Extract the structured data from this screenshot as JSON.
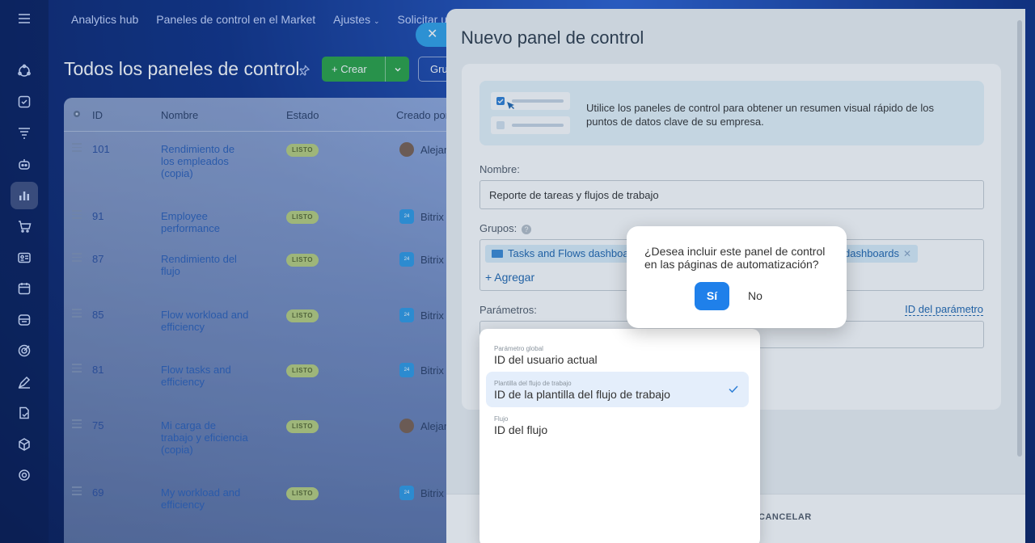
{
  "topnav": {
    "items": [
      "Analytics hub",
      "Paneles de control en el Market",
      "Ajustes",
      "Solicitar u"
    ]
  },
  "page": {
    "title": "Todos los paneles de control",
    "create_label": "+ Crear",
    "groups_label": "Gru"
  },
  "table": {
    "headers": {
      "id": "ID",
      "name": "Nombre",
      "status": "Estado",
      "creator": "Creado por"
    },
    "rows": [
      {
        "id": "101",
        "name": "Rendimiento de los empleados (copia)",
        "status": "LISTO",
        "creator": "Alejan"
      },
      {
        "id": "91",
        "name": "Employee performance",
        "status": "LISTO",
        "creator": "Bitrix"
      },
      {
        "id": "87",
        "name": "Rendimiento del flujo",
        "status": "LISTO",
        "creator": "Bitrix"
      },
      {
        "id": "85",
        "name": "Flow workload and efficiency",
        "status": "LISTO",
        "creator": "Bitrix"
      },
      {
        "id": "81",
        "name": "Flow tasks and efficiency",
        "status": "LISTO",
        "creator": "Bitrix"
      },
      {
        "id": "75",
        "name": "Mi carga de trabajo y eficiencia (copia)",
        "status": "LISTO",
        "creator": "Alejan"
      },
      {
        "id": "69",
        "name": "My workload and efficiency",
        "status": "LISTO",
        "creator": "Bitrix"
      }
    ],
    "bitrix_badge": "24"
  },
  "panel": {
    "title": "Nuevo panel de control",
    "info_text": "Utilice los paneles de control para obtener un resumen visual rápido de los puntos de datos clave de su empresa.",
    "name_label": "Nombre:",
    "name_value": "Reporte de tareas y flujos de trabajo",
    "groups_label": "Grupos:",
    "help": "?",
    "group_chips": [
      "Tasks and Flows dashboa",
      "dashboards"
    ],
    "add_label": "+ Agregar",
    "params_label": "Parámetros:",
    "param_id_link": "ID del parámetro",
    "cancel_label": "CANCELAR"
  },
  "dropdown": {
    "items": [
      {
        "caption": "Parámetro global",
        "label": "ID del usuario actual",
        "selected": false
      },
      {
        "caption": "Plantilla del flujo de trabajo",
        "label": "ID de la plantilla del flujo de trabajo",
        "selected": true
      },
      {
        "caption": "Flujo",
        "label": "ID del flujo",
        "selected": false
      }
    ]
  },
  "confirm": {
    "question": "¿Desea incluir este panel de control en las páginas de automatización?",
    "yes": "Sí",
    "no": "No"
  },
  "colors": {
    "accent_blue": "#1f80ea",
    "create_green": "#29a344",
    "status_badge": "#b9cf7d"
  }
}
